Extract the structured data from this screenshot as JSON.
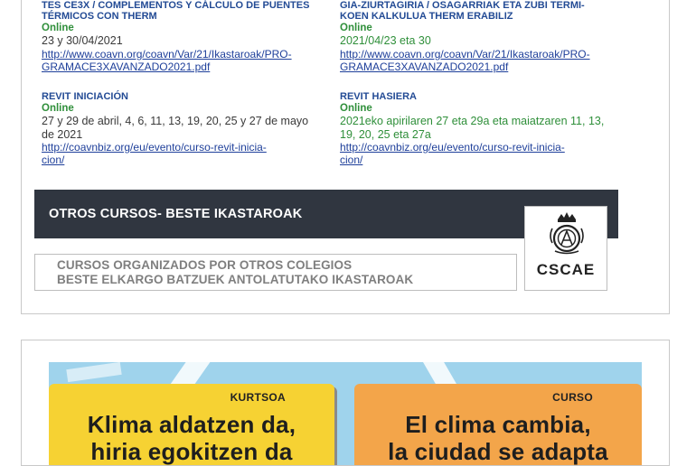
{
  "courses": {
    "left": [
      {
        "title_lines": [
          "TES CE3X / COMPLEMENTOS Y CÁLCULO DE PUENTES",
          "TÉRMICOS CON THERM"
        ],
        "mode": "Online",
        "date_lines": [
          "23 y 30/04/2021"
        ],
        "link_lines": [
          "http://www.coavn.org/coavn/Var/21/Ikastaroak/PRO-",
          "GRAMACE3XAVANZADO2021.pdf"
        ]
      },
      {
        "title_lines": [
          "REVIT INICIACIÓN"
        ],
        "mode": "Online",
        "date_lines": [
          "27 y 29 de abril, 4, 6, 11, 13, 19, 20, 25 y 27 de mayo",
          "de 2021"
        ],
        "link_lines": [
          "http://coavnbiz.org/eu/evento/curso-revit-inicia-",
          "cion/"
        ]
      }
    ],
    "right": [
      {
        "title_lines": [
          "GIA-ZIURTAGIRIA / OSAGARRIAK ETA ZUBI TERMI-",
          "KOEN KALKULUA THERM ERABILIZ"
        ],
        "mode": "Online",
        "date_lines": [
          "2021/04/23 eta 30"
        ],
        "link_lines": [
          "http://www.coavn.org/coavn/Var/21/Ikastaroak/PRO-",
          "GRAMACE3XAVANZADO2021.pdf"
        ]
      },
      {
        "title_lines": [
          "REVIT HASIERA"
        ],
        "mode": "Online",
        "date_lines": [
          "2021eko apirilaren 27 eta 29a eta maiatzaren 11, 13,",
          "19, 20, 25 eta 27a"
        ],
        "link_lines": [
          "http://coavnbiz.org/eu/evento/curso-revit-inicia-",
          "cion/"
        ]
      }
    ]
  },
  "banner": {
    "title": "OTROS  CURSOS- BESTE  IKASTAROAK",
    "sub1": "CURSOS ORGANIZADOS POR OTROS COLEGIOS",
    "sub2": "BESTE ELKARGO BATZUEK ANTOLATUTAKO IKASTAROAK",
    "logo_text": "CSCAE"
  },
  "promo": {
    "left_tag": "KURTSOA",
    "left_line1": "Klima aldatzen da,",
    "left_line2": "hiria egokitzen da",
    "right_tag": "CURSO",
    "right_line1": "El clima cambia,",
    "right_line2": "la ciudad se adapta"
  },
  "colors": {
    "title_blue": "#234b95",
    "online_green": "#2f8f3a",
    "banner_dark": "#303640",
    "panel_yellow": "#f6d233",
    "panel_orange": "#f3a54a",
    "sky_blue": "#9fd3ec"
  }
}
